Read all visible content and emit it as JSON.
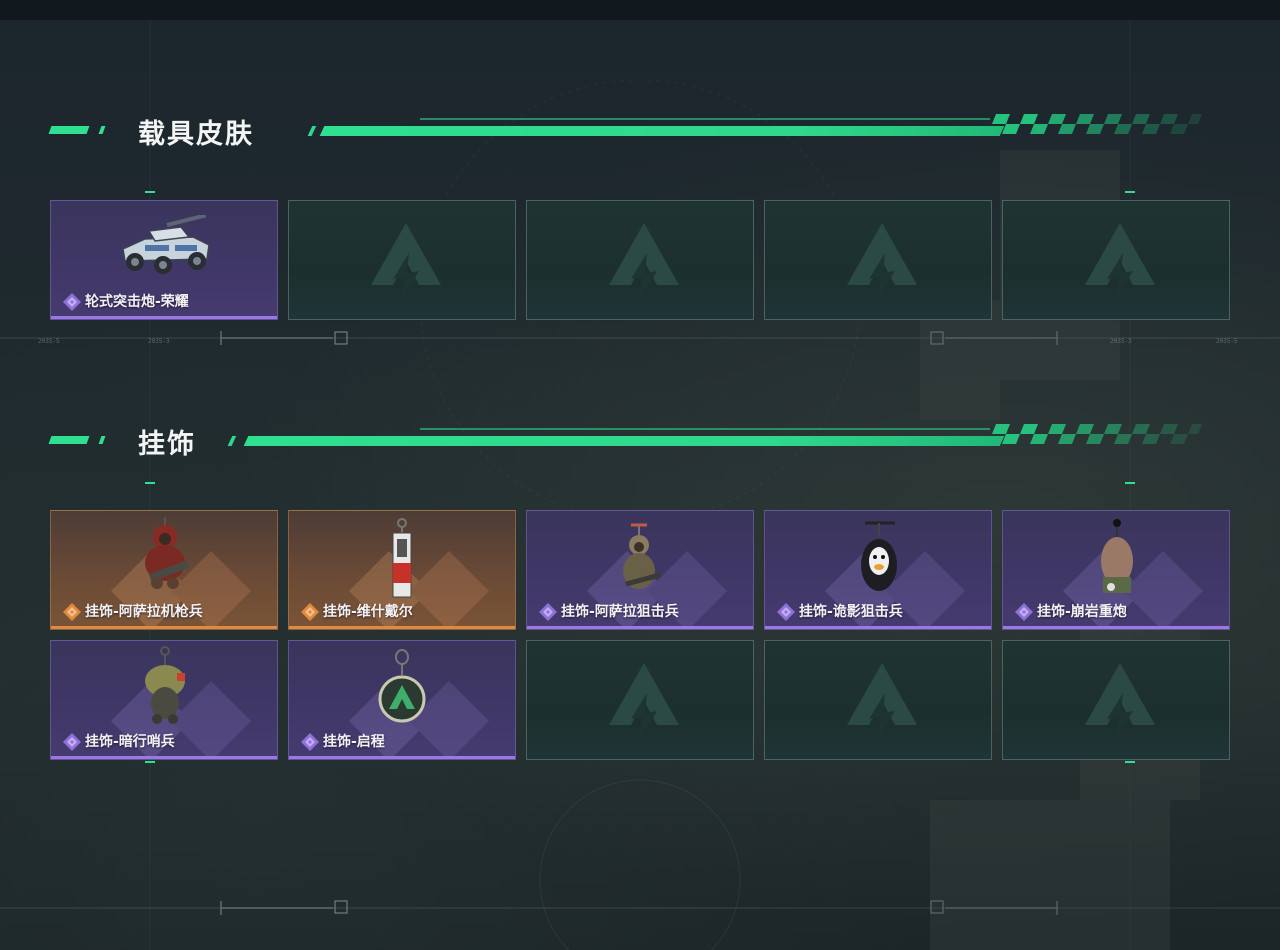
{
  "sections": [
    {
      "title": "载具皮肤",
      "items": [
        {
          "label": "轮式突击炮-荣耀",
          "rarity": "purple",
          "icon": "wheeled-assault-gun-icon"
        },
        {
          "label": "",
          "rarity": "empty"
        },
        {
          "label": "",
          "rarity": "empty"
        },
        {
          "label": "",
          "rarity": "empty"
        },
        {
          "label": "",
          "rarity": "empty"
        }
      ]
    },
    {
      "title": "挂饰",
      "items": [
        {
          "label": "挂饰-阿萨拉机枪兵",
          "rarity": "orange",
          "icon": "asala-gunner-charm-icon"
        },
        {
          "label": "挂饰-维什戴尔",
          "rarity": "orange",
          "icon": "vishdale-charm-icon"
        },
        {
          "label": "挂饰-阿萨拉狙击兵",
          "rarity": "purple",
          "icon": "asala-sniper-charm-icon"
        },
        {
          "label": "挂饰-诡影狙击兵",
          "rarity": "purple",
          "icon": "shadow-sniper-charm-icon"
        },
        {
          "label": "挂饰-崩岩重炮",
          "rarity": "purple",
          "icon": "rock-cannon-charm-icon"
        },
        {
          "label": "挂饰-暗行哨兵",
          "rarity": "purple",
          "icon": "dark-sentry-charm-icon"
        },
        {
          "label": "挂饰-启程",
          "rarity": "purple",
          "icon": "departure-charm-icon"
        },
        {
          "label": "",
          "rarity": "empty"
        },
        {
          "label": "",
          "rarity": "empty"
        },
        {
          "label": "",
          "rarity": "empty"
        }
      ]
    }
  ],
  "colors": {
    "accent": "#2ee08f",
    "rarity_purple": "#9b78e6",
    "rarity_orange": "#e08a3f",
    "empty_slot": "#1f3431"
  },
  "hud_marks": [
    "2035-5",
    "2035-3",
    "2035-3",
    "2035-5"
  ]
}
